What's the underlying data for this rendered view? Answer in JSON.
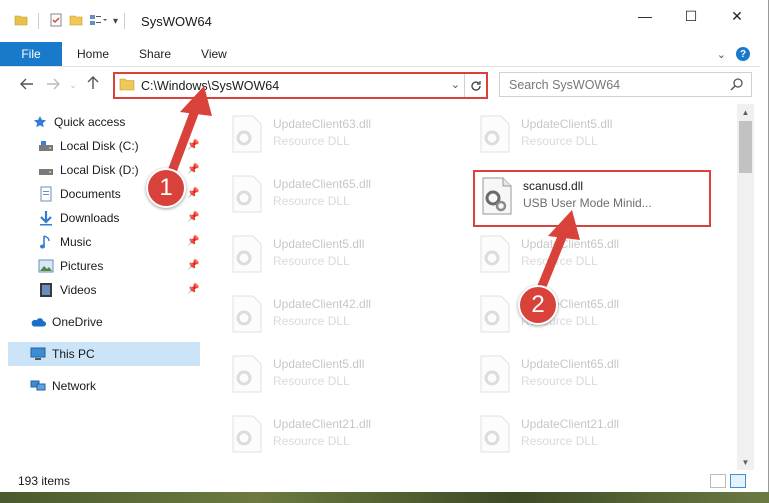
{
  "window": {
    "title": "SysWOW64",
    "controls": {
      "minimize": "—",
      "maximize": "☐",
      "close": "✕"
    }
  },
  "ribbon": {
    "file_tab": "File",
    "tabs": [
      "Home",
      "Share",
      "View"
    ],
    "help": "?"
  },
  "address_bar": {
    "path": "C:\\Windows\\SysWOW64"
  },
  "search": {
    "placeholder": "Search SysWOW64"
  },
  "sidebar": {
    "quick_access": "Quick access",
    "items": [
      {
        "label": "Local Disk (C:)",
        "icon": "drive-icon",
        "pinned": true
      },
      {
        "label": "Local Disk (D:)",
        "icon": "drive-icon",
        "pinned": true
      },
      {
        "label": "Documents",
        "icon": "documents-icon",
        "pinned": true
      },
      {
        "label": "Downloads",
        "icon": "downloads-icon",
        "pinned": true
      },
      {
        "label": "Music",
        "icon": "music-icon",
        "pinned": true
      },
      {
        "label": "Pictures",
        "icon": "pictures-icon",
        "pinned": true
      },
      {
        "label": "Videos",
        "icon": "videos-icon",
        "pinned": true
      }
    ],
    "onedrive": "OneDrive",
    "this_pc": "This PC",
    "network": "Network"
  },
  "files": {
    "left": [
      {
        "name": "UpdateClient63.dll",
        "desc": "Resource DLL"
      },
      {
        "name": "UpdateClient65.dll",
        "desc": "Resource DLL"
      },
      {
        "name": "UpdateClient5.dll",
        "desc": "Resource DLL"
      },
      {
        "name": "UpdateClient42.dll",
        "desc": "Resource DLL"
      },
      {
        "name": "UpdateClient5.dll",
        "desc": "Resource DLL"
      },
      {
        "name": "UpdateClient21.dll",
        "desc": "Resource DLL"
      }
    ],
    "right": [
      {
        "name": "UpdateClient5.dll",
        "desc": "Resource DLL"
      },
      {
        "name": "UpdateClient65.dll",
        "desc": "Resource DLL"
      },
      {
        "name": "UpdateClient65.dll",
        "desc": "Resource DLL"
      },
      {
        "name": "UpdateClient65.dll",
        "desc": "Resource DLL"
      },
      {
        "name": "UpdateClient21.dll",
        "desc": "Resource DLL"
      }
    ],
    "highlighted": {
      "name": "scanusd.dll",
      "desc": "USB User Mode Minid..."
    }
  },
  "status": {
    "item_count": "193 items"
  },
  "annotations": {
    "badge1": "1",
    "badge2": "2",
    "accent": "#d9413b"
  }
}
